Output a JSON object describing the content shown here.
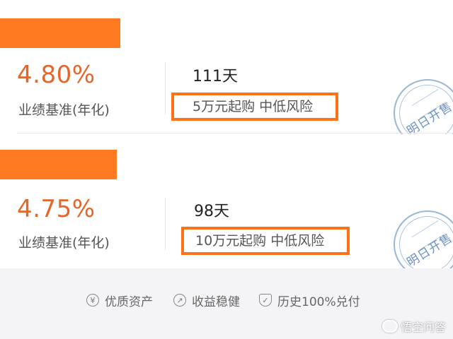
{
  "products": [
    {
      "rate": "4.80%",
      "rate_label": "业绩基准(年化)",
      "term": "111天",
      "tags": "5万元起购 中低风险",
      "stamp": "明日开售"
    },
    {
      "rate": "4.75%",
      "rate_label": "业绩基准(年化)",
      "term": "98天",
      "tags": "10万元起购 中低风险",
      "stamp": "明日开售"
    }
  ],
  "features": [
    {
      "icon": "yen-icon",
      "label": "优质资产"
    },
    {
      "icon": "trend-icon",
      "label": "收益稳健"
    },
    {
      "icon": "shield-icon",
      "label": "历史100%兑付"
    }
  ],
  "watermark": "悟空问答",
  "colors": {
    "accent": "#ff7a21",
    "rate": "#e5662a",
    "stamp": "#6c92c6",
    "footer_bg": "#f4f4f6"
  }
}
